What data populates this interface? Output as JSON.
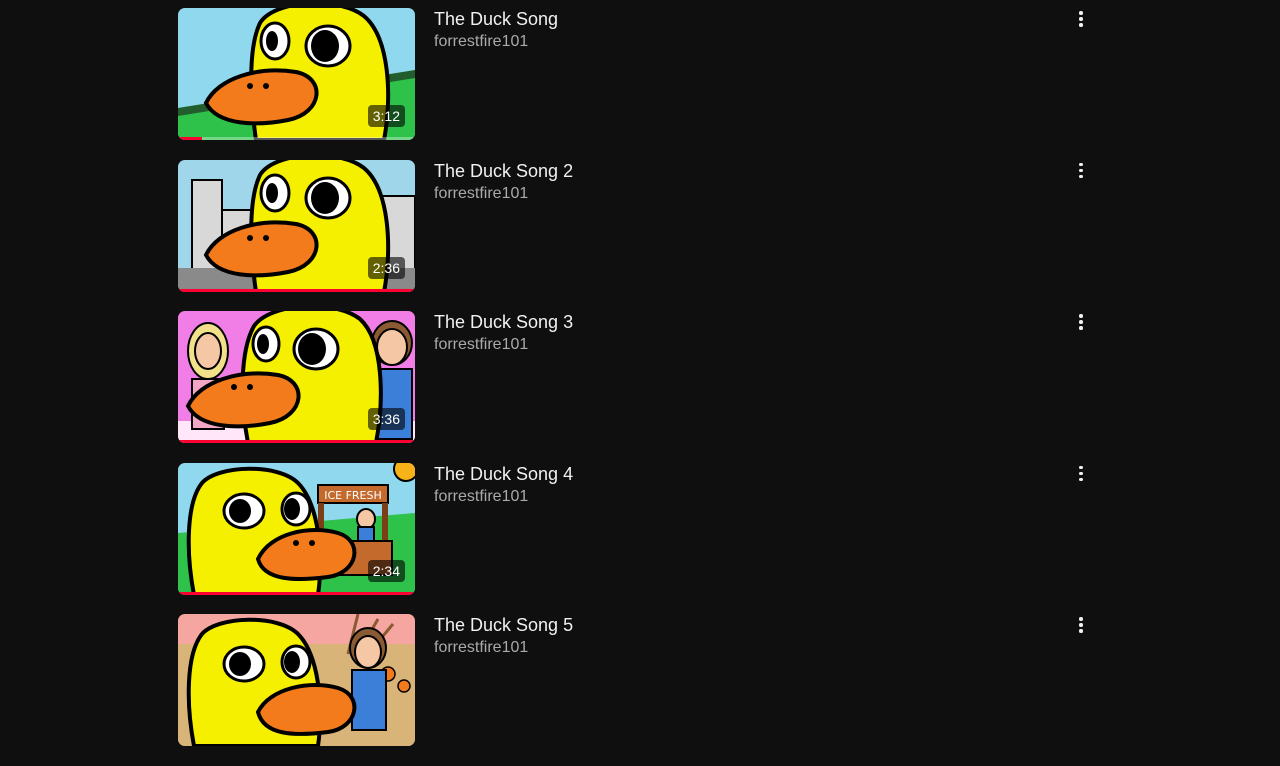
{
  "videos": [
    {
      "title": "The Duck Song",
      "channel": "forrestfire101",
      "duration": "3:12",
      "progress": 0.1,
      "scene": "grass",
      "thumb_icon": "duck-thumbnail-icon"
    },
    {
      "title": "The Duck Song 2",
      "channel": "forrestfire101",
      "duration": "2:36",
      "progress": 1.0,
      "scene": "city",
      "thumb_icon": "duck-city-thumbnail-icon"
    },
    {
      "title": "The Duck Song 3",
      "channel": "forrestfire101",
      "duration": "3:36",
      "progress": 1.0,
      "scene": "pink",
      "thumb_icon": "duck-friends-thumbnail-icon"
    },
    {
      "title": "The Duck Song 4",
      "channel": "forrestfire101",
      "duration": "2:34",
      "progress": 1.0,
      "scene": "lemonade",
      "stand_sign": "ICE FRESH",
      "thumb_icon": "duck-lemonade-thumbnail-icon"
    },
    {
      "title": "The Duck Song 5",
      "channel": "forrestfire101",
      "duration": "",
      "progress": 0,
      "scene": "autumn",
      "thumb_icon": "duck-autumn-thumbnail-icon"
    }
  ],
  "menu_icon": "more-vert-icon",
  "colors": {
    "background": "#0f0f0f",
    "title": "#f1f1f1",
    "channel": "#aaaaaa",
    "progress": "#ff0033",
    "duck": "#f5ef00",
    "beak": "#f47b1c"
  }
}
